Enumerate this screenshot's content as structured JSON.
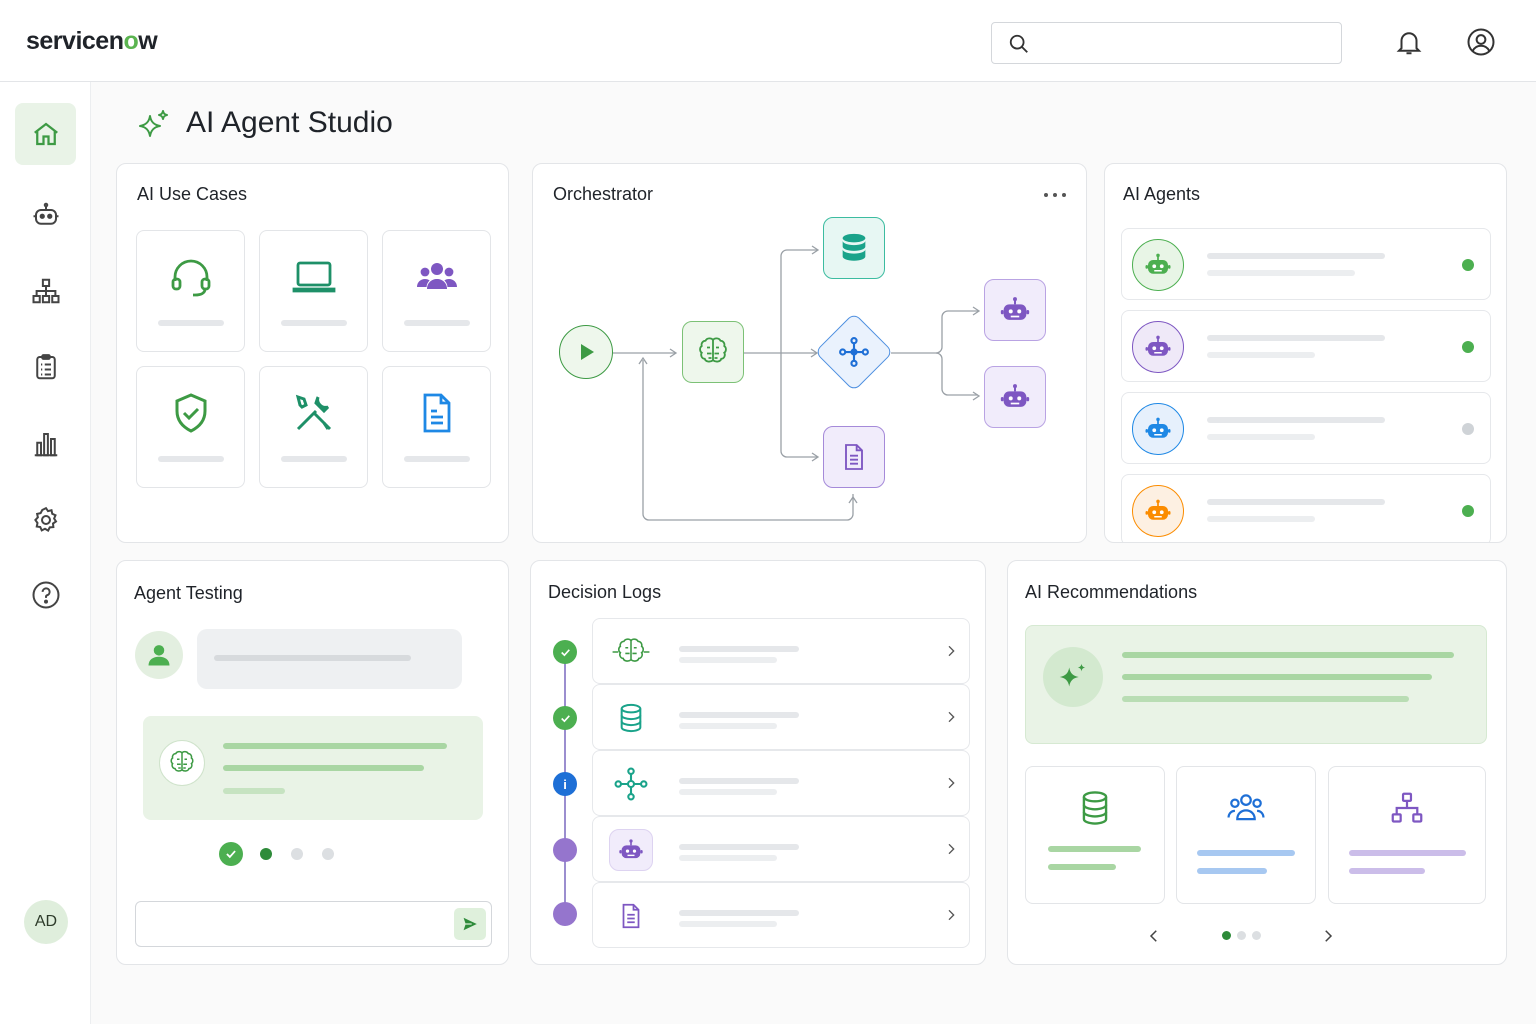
{
  "app": {
    "logo_text": "servicenow",
    "logo_o": "o",
    "logo_prefix": "servicen",
    "logo_suffix": "w"
  },
  "header": {
    "search_placeholder": "",
    "icons": [
      "search-icon",
      "bell-icon",
      "user-icon"
    ]
  },
  "sidebar": {
    "items": [
      {
        "name": "home",
        "icon": "home-icon",
        "active": true
      },
      {
        "name": "agents",
        "icon": "robot-icon"
      },
      {
        "name": "orchestration",
        "icon": "hierarchy-icon"
      },
      {
        "name": "tasks",
        "icon": "clipboard-icon"
      },
      {
        "name": "analytics",
        "icon": "bar-chart-icon"
      },
      {
        "name": "settings",
        "icon": "gear-icon"
      },
      {
        "name": "help",
        "icon": "help-icon"
      }
    ],
    "avatar_initials": "AD"
  },
  "page": {
    "title": "AI Agent Studio"
  },
  "use_cases": {
    "title": "AI Use Cases",
    "tiles": [
      "headset-icon",
      "laptop-icon",
      "users-icon",
      "shield-check-icon",
      "tools-icon",
      "document-icon"
    ]
  },
  "orchestrator": {
    "title": "Orchestrator",
    "menu_icon": "more-horizontal-icon",
    "nodes": [
      "play-icon",
      "brain-icon",
      "database-icon",
      "hub-icon",
      "document-icon",
      "robot-icon",
      "robot-icon"
    ]
  },
  "agents": {
    "title": "AI Agents",
    "rows": [
      {
        "icon": "robot-icon",
        "color": "#4caf50",
        "status": "#4caf50"
      },
      {
        "icon": "robot-icon",
        "color": "#7e57c2",
        "status": "#4caf50"
      },
      {
        "icon": "robot-icon",
        "color": "#1e88e5",
        "status": "#cfd3d7"
      },
      {
        "icon": "robot-icon",
        "color": "#fb8c00",
        "status": "#4caf50"
      }
    ]
  },
  "testing": {
    "title": "Agent Testing",
    "send_icon": "send-icon"
  },
  "logs": {
    "title": "Decision Logs",
    "rows": [
      {
        "status": "check",
        "icon": "brain-icon"
      },
      {
        "status": "check",
        "icon": "database-icon"
      },
      {
        "status": "info",
        "status_text": "i",
        "icon": "hub-icon"
      },
      {
        "status": "pending",
        "icon": "robot-icon"
      },
      {
        "status": "pending",
        "icon": "document-icon"
      }
    ]
  },
  "recommendations": {
    "title": "AI Recommendations",
    "tiles": [
      "database-icon",
      "users-icon",
      "hierarchy-icon"
    ]
  },
  "colors": {
    "brand_green": "#5bb450",
    "purple": "#7e57c2",
    "blue": "#1e88e5",
    "teal": "#1aa38a"
  }
}
